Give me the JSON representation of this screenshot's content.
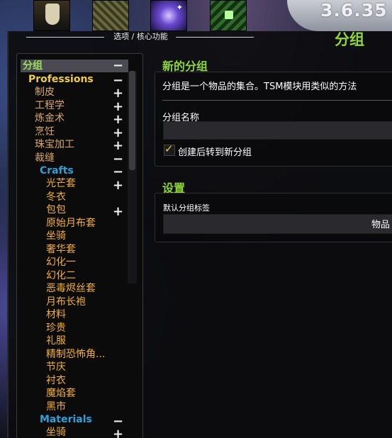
{
  "window": {
    "header_title": "选项 / 核心功能",
    "panel_title": "分组",
    "version": "3.6.35"
  },
  "top_icons": [
    "goblet-icon",
    "ornate-pattern-icon",
    "crystal-icon",
    "green-emblem-icon"
  ],
  "tree": {
    "root": "分组",
    "professions": "Professions",
    "prof_items": [
      "制皮",
      "工程学",
      "炼金术",
      "烹饪",
      "珠宝加工",
      "裁缝"
    ],
    "crafts": "Crafts",
    "craft_items": [
      "光芒套",
      "冬衣",
      "包包",
      "原始月布套",
      "坐骑",
      "奢华套",
      "幻化一",
      "幻化二",
      "恶毒烬丝套",
      "月布长袍",
      "材料",
      "珍贵",
      "礼服",
      "精制恐怖角...",
      "节庆",
      "衬衣",
      "魔焰套",
      "黑市"
    ],
    "materials": "Materials",
    "material_items": [
      "坐骑"
    ]
  },
  "new_group": {
    "heading": "新的分组",
    "description": "分组是一个物品的集合。TSM模块用类似的方法",
    "name_label": "分组名称",
    "name_value": "",
    "checkbox_label": "创建后转到新分组",
    "checkbox_checked": true
  },
  "settings": {
    "heading": "设置",
    "default_label": "默认分组标签",
    "default_value": "物品"
  },
  "colors": {
    "accent_green": "#8fd63a",
    "profession_yellow": "#f0d040",
    "category_blue": "#2ea0d8",
    "leaf_orange": "#f4b030"
  }
}
